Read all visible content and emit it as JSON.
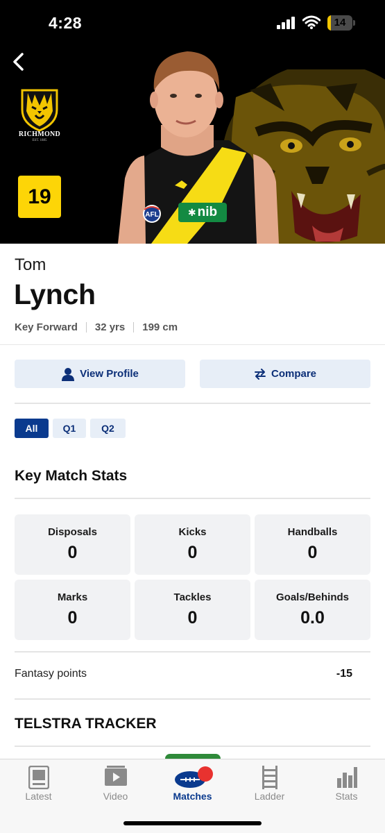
{
  "status_bar": {
    "time": "4:28",
    "battery": "14",
    "battery_level": 0.14
  },
  "club": {
    "name": "RICHMOND",
    "est": "EST. 1885",
    "brand_color": "#fdd507"
  },
  "player": {
    "number": "19",
    "first_name": "Tom",
    "last_name": "Lynch",
    "position": "Key Forward",
    "age": "32 yrs",
    "height": "199 cm",
    "sponsor": "nib",
    "league": "AFL"
  },
  "actions": {
    "view_profile": "View Profile",
    "compare": "Compare"
  },
  "quarter_tabs": [
    {
      "label": "All",
      "active": true
    },
    {
      "label": "Q1",
      "active": false
    },
    {
      "label": "Q2",
      "active": false
    }
  ],
  "key_match_stats": {
    "title": "Key Match Stats",
    "tiles": [
      {
        "label": "Disposals",
        "value": "0"
      },
      {
        "label": "Kicks",
        "value": "0"
      },
      {
        "label": "Handballs",
        "value": "0"
      },
      {
        "label": "Marks",
        "value": "0"
      },
      {
        "label": "Tackles",
        "value": "0"
      },
      {
        "label": "Goals/Behinds",
        "value": "0.0"
      }
    ]
  },
  "fantasy": {
    "label": "Fantasy points",
    "value": "-15"
  },
  "tracker": {
    "title": "TELSTRA TRACKER"
  },
  "bottom_nav": {
    "items": [
      {
        "label": "Latest",
        "icon": "news-icon",
        "active": false
      },
      {
        "label": "Video",
        "icon": "video-icon",
        "active": false
      },
      {
        "label": "Matches",
        "icon": "football-icon",
        "active": true
      },
      {
        "label": "Ladder",
        "icon": "ladder-icon",
        "active": false
      },
      {
        "label": "Stats",
        "icon": "bar-chart-icon",
        "active": false
      }
    ]
  },
  "colors": {
    "accent": "#0a3a8e",
    "button_bg": "#e7eef7",
    "notification": "#e8322f"
  }
}
